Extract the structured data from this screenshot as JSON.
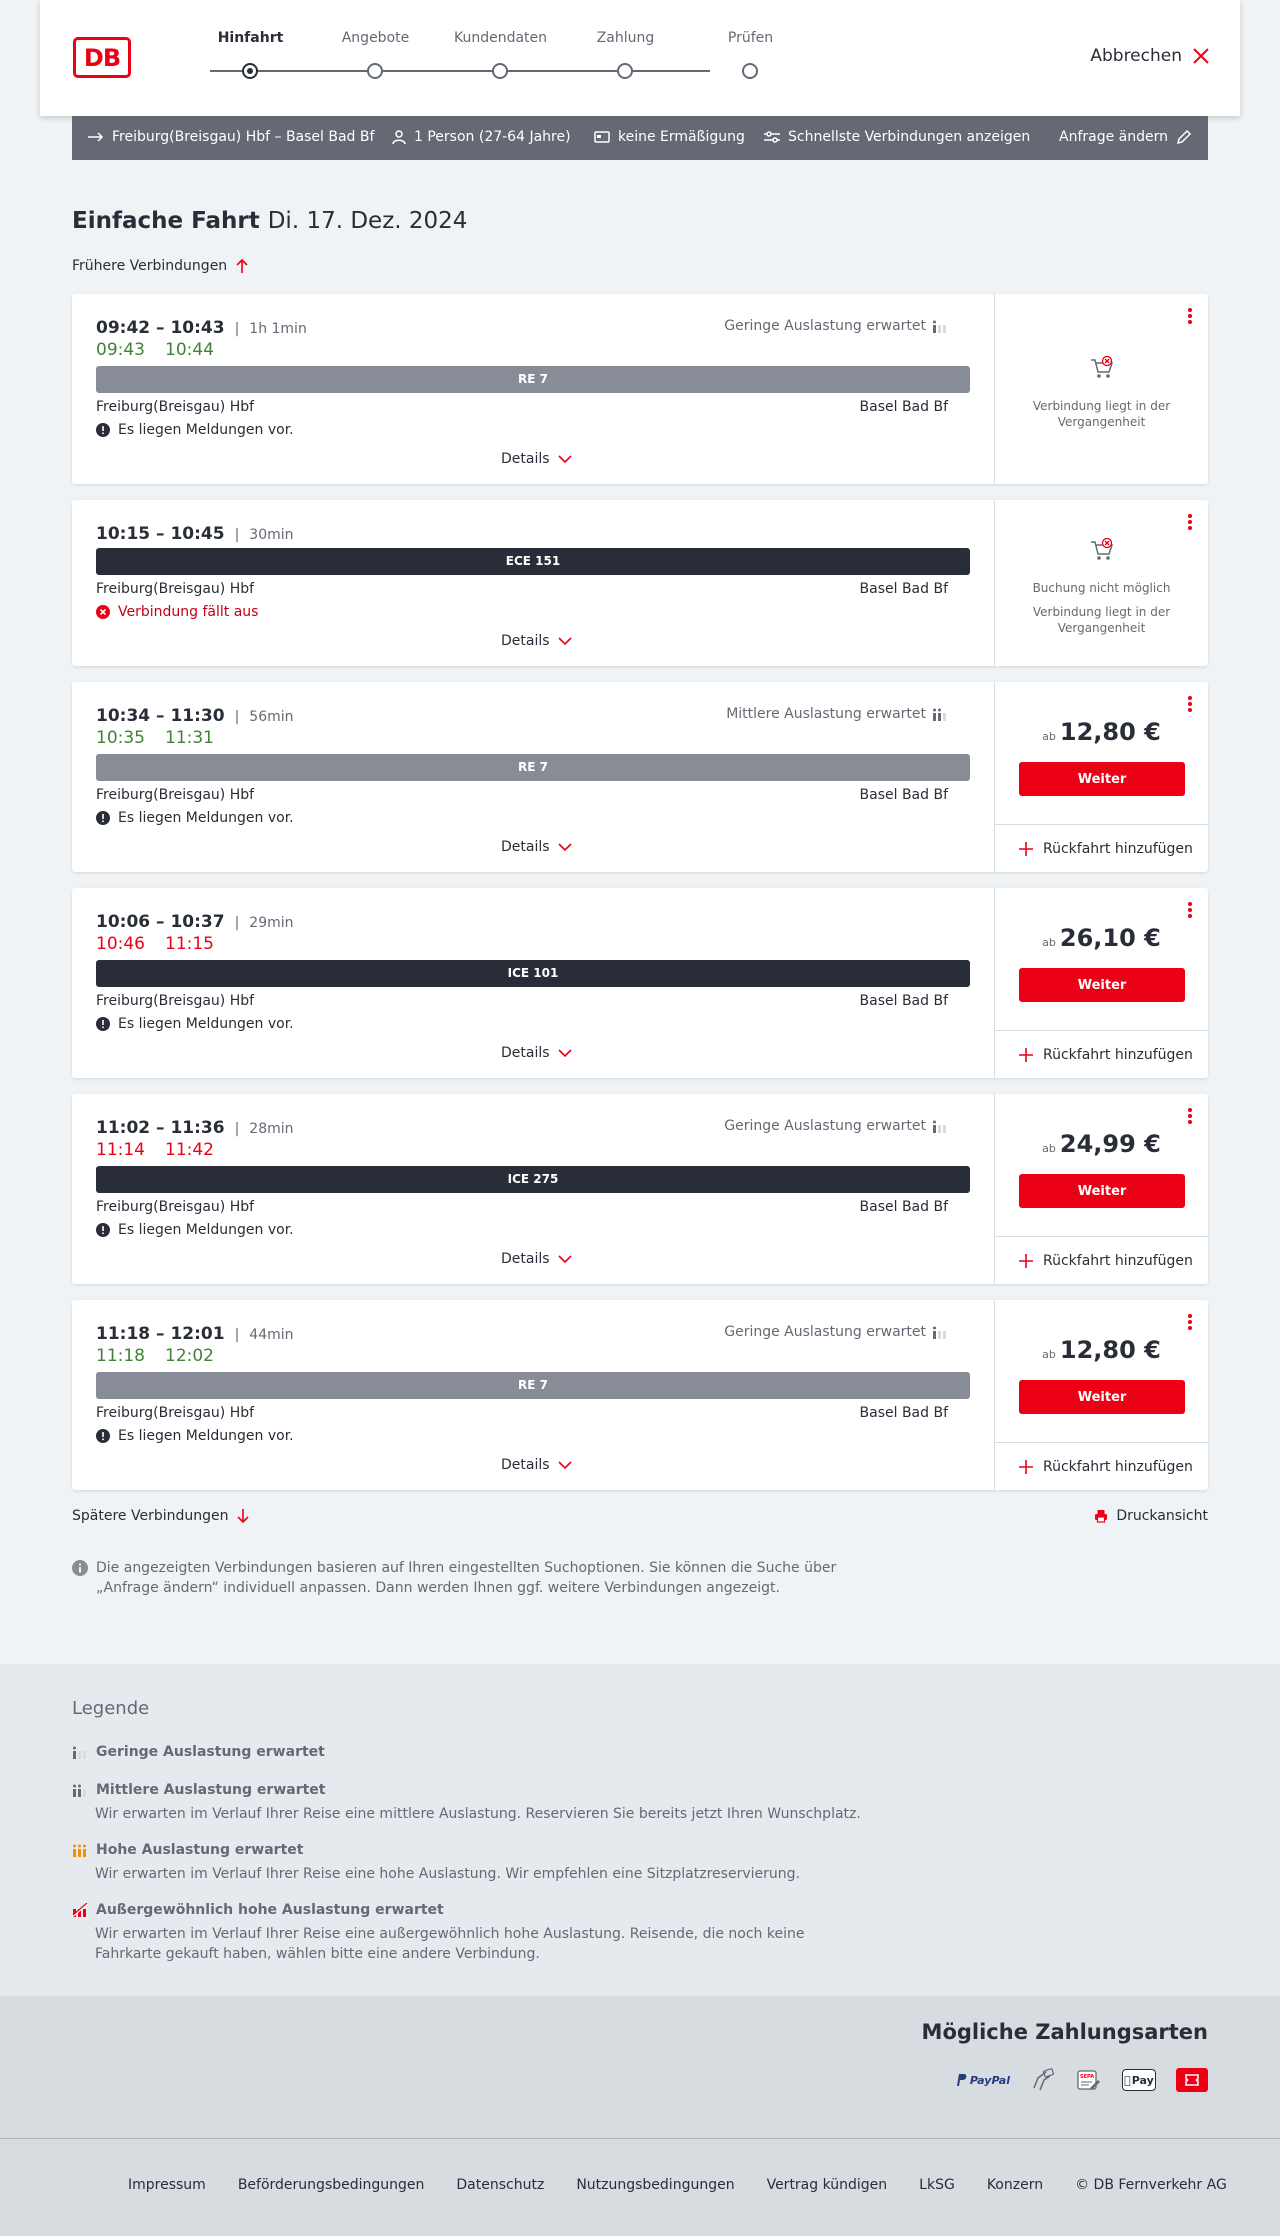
{
  "header": {
    "logo_text": "DB",
    "steps": [
      {
        "label": "Hinfahrt",
        "active": true
      },
      {
        "label": "Angebote",
        "active": false
      },
      {
        "label": "Kundendaten",
        "active": false
      },
      {
        "label": "Zahlung",
        "active": false
      },
      {
        "label": "Prüfen",
        "active": false
      }
    ],
    "cancel_label": "Abbrechen"
  },
  "query": {
    "route": "Freiburg(Breisgau) Hbf – Basel Bad Bf",
    "passengers": "1 Person (27-64 Jahre)",
    "discount": "keine Ermäßigung",
    "fastest": "Schnellste Verbindungen anzeigen",
    "change": "Anfrage ändern"
  },
  "title": {
    "main": "Einfache Fahrt",
    "date": "Di. 17. Dez. 2024"
  },
  "earlier_label": "Frühere Verbindungen",
  "later_label": "Spätere Verbindungen",
  "print_label": "Druckansicht",
  "details_label": "Details",
  "return_label": "Rückfahrt hinzufügen",
  "weiter_label": "Weiter",
  "ab_label": "ab",
  "connections": [
    {
      "times": "09:42 – 10:43",
      "duration": "1h 1min",
      "rt_dep": "09:43",
      "rt_arr": "10:44",
      "rt_color": "green",
      "auslastung": "Geringe Auslastung erwartet",
      "train": "RE 7",
      "train_type": "re",
      "from": "Freiburg(Breisgau) Hbf",
      "to": "Basel Bad Bf",
      "message": "Es liegen Meldungen vor.",
      "message_type": "info",
      "status": [
        "Verbindung liegt in der Vergangenheit"
      ]
    },
    {
      "times": "10:15 – 10:45",
      "duration": "30min",
      "rt_dep": "",
      "rt_arr": "",
      "rt_color": "",
      "auslastung": "",
      "train": "ECE 151",
      "train_type": "ice",
      "from": "Freiburg(Breisgau) Hbf",
      "to": "Basel Bad Bf",
      "message": "Verbindung fällt aus",
      "message_type": "error",
      "status": [
        "Buchung nicht möglich",
        "Verbindung liegt in der Vergangenheit"
      ]
    },
    {
      "times": "10:34 – 11:30",
      "duration": "56min",
      "rt_dep": "10:35",
      "rt_arr": "11:31",
      "rt_color": "green",
      "auslastung": "Mittlere Auslastung erwartet",
      "train": "RE 7",
      "train_type": "re",
      "from": "Freiburg(Breisgau) Hbf",
      "to": "Basel Bad Bf",
      "message": "Es liegen Meldungen vor.",
      "message_type": "info",
      "price": "12,80 €"
    },
    {
      "times": "10:06 – 10:37",
      "duration": "29min",
      "rt_dep": "10:46",
      "rt_arr": "11:15",
      "rt_color": "red",
      "auslastung": "",
      "train": "ICE 101",
      "train_type": "ice",
      "from": "Freiburg(Breisgau) Hbf",
      "to": "Basel Bad Bf",
      "message": "Es liegen Meldungen vor.",
      "message_type": "info",
      "price": "26,10 €"
    },
    {
      "times": "11:02 – 11:36",
      "duration": "28min",
      "rt_dep": "11:14",
      "rt_arr": "11:42",
      "rt_color": "red",
      "auslastung": "Geringe Auslastung erwartet",
      "train": "ICE 275",
      "train_type": "ice",
      "from": "Freiburg(Breisgau) Hbf",
      "to": "Basel Bad Bf",
      "message": "Es liegen Meldungen vor.",
      "message_type": "info",
      "price": "24,99 €"
    },
    {
      "times": "11:18 – 12:01",
      "duration": "44min",
      "rt_dep": "11:18",
      "rt_arr": "12:02",
      "rt_color": "green",
      "auslastung": "Geringe Auslastung erwartet",
      "train": "RE 7",
      "train_type": "re",
      "from": "Freiburg(Breisgau) Hbf",
      "to": "Basel Bad Bf",
      "message": "Es liegen Meldungen vor.",
      "message_type": "info",
      "price": "12,80 €"
    }
  ],
  "info_text": "Die angezeigten Verbindungen basieren auf Ihren eingestellten Suchoptionen. Sie können die Suche über „Anfrage ändern“ individuell anpassen. Dann werden Ihnen ggf. weitere Verbindungen angezeigt.",
  "legend": {
    "title": "Legende",
    "items": [
      {
        "label": "Geringe Auslastung erwartet",
        "desc": "",
        "level": 1
      },
      {
        "label": "Mittlere Auslastung erwartet",
        "desc": "Wir erwarten im Verlauf Ihrer Reise eine mittlere Auslastung. Reservieren Sie bereits jetzt Ihren Wunschplatz.",
        "level": 2
      },
      {
        "label": "Hohe Auslastung erwartet",
        "desc": "Wir erwarten im Verlauf Ihrer Reise eine hohe Auslastung. Wir empfehlen eine Sitzplatzreservierung.",
        "level": 3
      },
      {
        "label": "Außergewöhnlich hohe Auslastung erwartet",
        "desc": "Wir erwarten im Verlauf Ihrer Reise eine außergewöhnlich hohe Auslastung. Reisende, die noch keine Fahrkarte gekauft haben, wählen bitte eine andere Verbindung.",
        "level": 4
      }
    ]
  },
  "payment": {
    "title": "Mögliche Zahlungsarten",
    "methods": [
      "PayPal",
      "SEPA",
      "Pay"
    ]
  },
  "footer": {
    "links": [
      "Impressum",
      "Beförderungsbedingungen",
      "Datenschutz",
      "Nutzungsbedingungen",
      "Vertrag kündigen",
      "LkSG",
      "Konzern",
      "© DB Fernverkehr AG"
    ]
  },
  "colors": {
    "accent": "#ec0016",
    "green": "#408335",
    "dark": "#282d37",
    "grey": "#646973"
  }
}
